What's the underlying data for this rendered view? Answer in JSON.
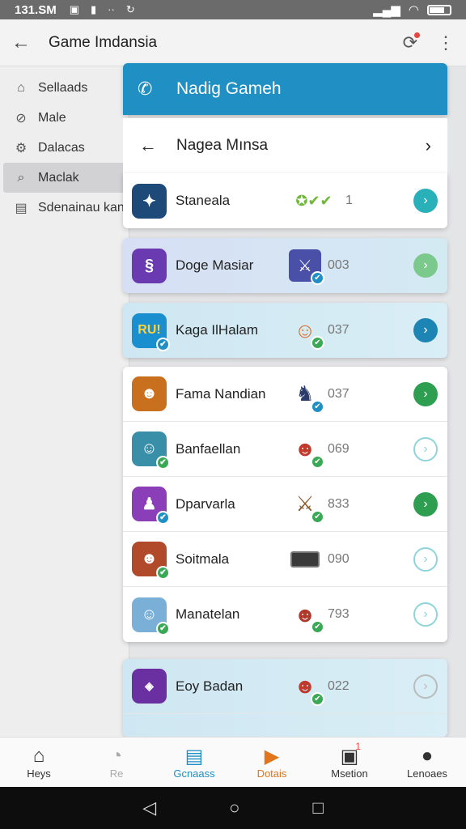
{
  "status_bar": {
    "time": "131.SM"
  },
  "app_bar": {
    "title": "Game Imdansia"
  },
  "drawer": {
    "items": [
      {
        "label": "Sellaads",
        "icon": "home-icon"
      },
      {
        "label": "Male",
        "icon": "compass-icon"
      },
      {
        "label": "Dalacas",
        "icon": "gear-icon"
      },
      {
        "label": "Maclak",
        "icon": "search-icon",
        "active": true
      },
      {
        "label": "Sdenainau kant",
        "icon": "document-icon"
      }
    ]
  },
  "panel": {
    "header_title": "Nadig Gameh",
    "sub_title": "Nagea Mınsa"
  },
  "rows": [
    {
      "name": "Staneala",
      "count": "1",
      "button": "teal"
    },
    {
      "name": "Doge Masiar",
      "count": "003",
      "button": "lightgreen"
    },
    {
      "name": "Kaga IlHalam",
      "count": "037",
      "button": "blue"
    },
    {
      "name": "Fama Nandian",
      "count": "037",
      "button": "green"
    },
    {
      "name": "Banfaellan",
      "count": "069",
      "button": "outline"
    },
    {
      "name": "Dparvarla",
      "count": "833",
      "button": "green"
    },
    {
      "name": "Soitmala",
      "count": "090",
      "button": "outline"
    },
    {
      "name": "Manatelan",
      "count": "793",
      "button": "outline"
    },
    {
      "name": "Eoy Badan",
      "count": "022",
      "button": "outline-gray"
    }
  ],
  "bottom_nav": [
    {
      "label": "Heys"
    },
    {
      "label": "Re"
    },
    {
      "label": "Gcnaass"
    },
    {
      "label": "Dotais"
    },
    {
      "label": "Msetion",
      "badge": "1"
    },
    {
      "label": "Lenoaes"
    }
  ],
  "colors": {
    "accent": "#1f8fc4",
    "green": "#2e9f50",
    "orange": "#e0751c"
  }
}
